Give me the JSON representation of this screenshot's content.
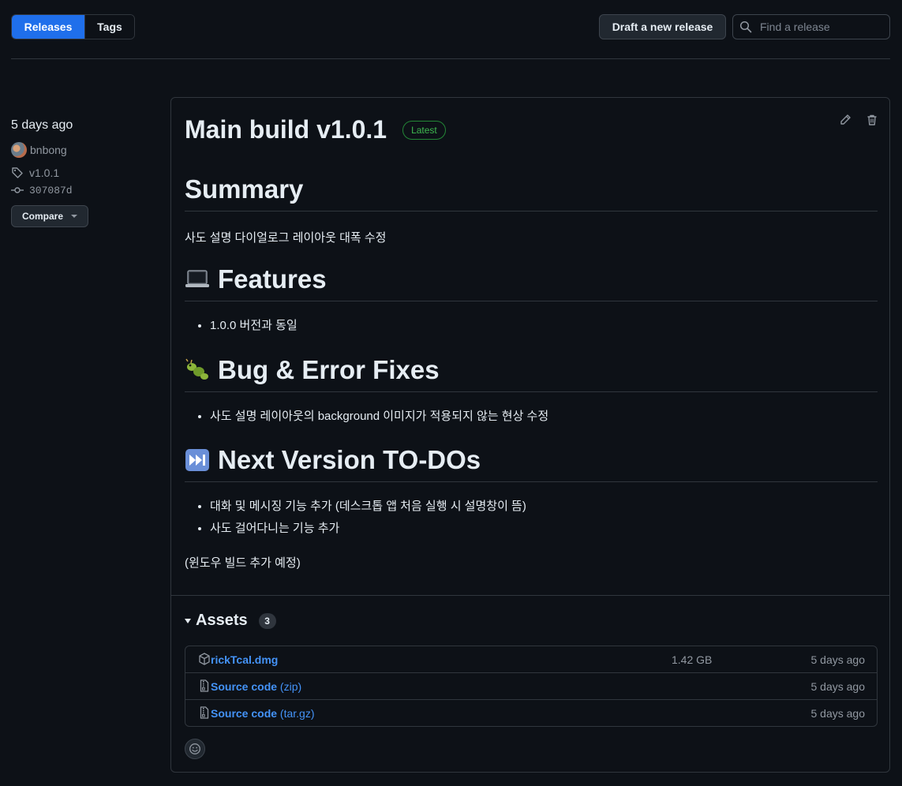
{
  "nav": {
    "releases_label": "Releases",
    "tags_label": "Tags",
    "draft_label": "Draft a new release",
    "search_placeholder": "Find a release"
  },
  "release": {
    "date": "5 days ago",
    "author": "bnbong",
    "tag": "v1.0.1",
    "commit": "307087d",
    "compare_label": "Compare",
    "title": "Main build v1.0.1",
    "latest_label": "Latest",
    "body": {
      "summary_heading": "Summary",
      "summary_text": "사도 설명 다이얼로그 레이아웃 대폭 수정",
      "features_heading": "Features",
      "features_items": [
        "1.0.0 버전과 동일"
      ],
      "bugs_heading": "Bug & Error Fixes",
      "bugs_items": [
        "사도 설명 레이아웃의 background 이미지가 적용되지 않는 현상 수정"
      ],
      "todo_heading": "Next Version TO-DOs",
      "todo_items": [
        "대화 및 메시징 기능 추가 (데스크톱 앱 처음 실행 시 설명창이 뜸)",
        "사도 걸어다니는 기능 추가"
      ],
      "footer_note": "(윈도우 빌드 추가 예정)"
    },
    "assets": {
      "title": "Assets",
      "count": "3",
      "items": [
        {
          "name": "rickTcal.dmg",
          "ext": "",
          "size": "1.42 GB",
          "when": "5 days ago",
          "icon": "package-icon"
        },
        {
          "name": "Source code",
          "ext": "(zip)",
          "size": "",
          "when": "5 days ago",
          "icon": "file-zip-icon"
        },
        {
          "name": "Source code",
          "ext": "(tar.gz)",
          "size": "",
          "when": "5 days ago",
          "icon": "file-zip-icon"
        }
      ]
    }
  },
  "colors": {
    "background": "#0d1117",
    "accent": "#1f6feb",
    "link": "#4493f8",
    "latest_green": "#3fb950"
  }
}
